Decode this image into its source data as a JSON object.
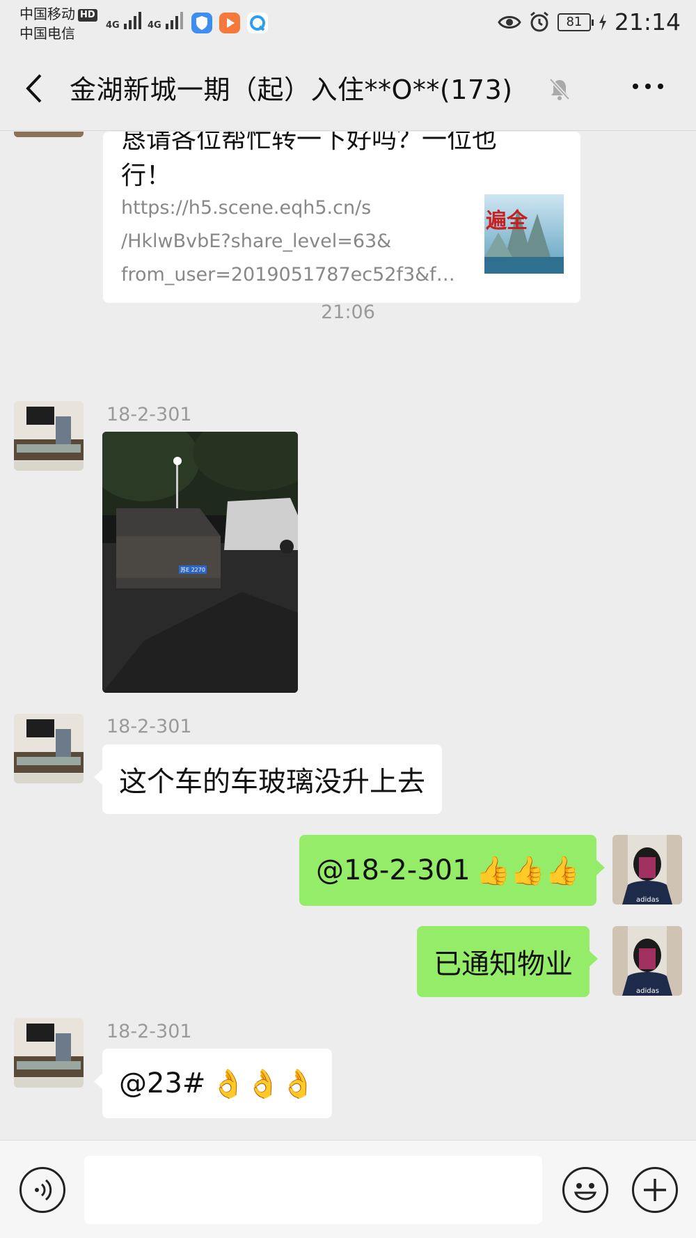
{
  "status_bar": {
    "carrier_1": "中国移动",
    "hd_badge": "HD",
    "carrier_2": "中国电信",
    "network_1": "4G",
    "network_2": "4G",
    "battery": "81",
    "time": "21:14"
  },
  "header": {
    "title": "金湖新城一期（起）入住**O**(173)",
    "icons": [
      "back-icon",
      "mute-icon",
      "more-icon"
    ]
  },
  "messages": {
    "link_card": {
      "title": "恳请各位帮忙转一下好吗？一位也行！",
      "url_lines": [
        "https://h5.scene.eqh5.cn/s",
        "/HklwBvbE?share_level=63&",
        "from_user=2019051787ec52f3&fro..."
      ]
    },
    "time_divider": "21:06",
    "msg_photo": {
      "sender": "18-2-301",
      "plate": "苏E 2270"
    },
    "msg_text_1": {
      "sender": "18-2-301",
      "text": "这个车的车玻璃没升上去"
    },
    "msg_me_1": {
      "text": "@18-2-301",
      "emoji": "👍👍👍"
    },
    "msg_me_2": {
      "text": "已通知物业"
    },
    "msg_text_2": {
      "sender": "18-2-301",
      "text": "@23#",
      "emoji": "👌👌👌"
    }
  },
  "input_bar": {
    "value": "",
    "icons": [
      "voice-icon",
      "emoji-icon",
      "plus-icon"
    ]
  },
  "colors": {
    "background": "#ededed",
    "bubble_self": "#95ec69",
    "bubble_other": "#ffffff"
  }
}
